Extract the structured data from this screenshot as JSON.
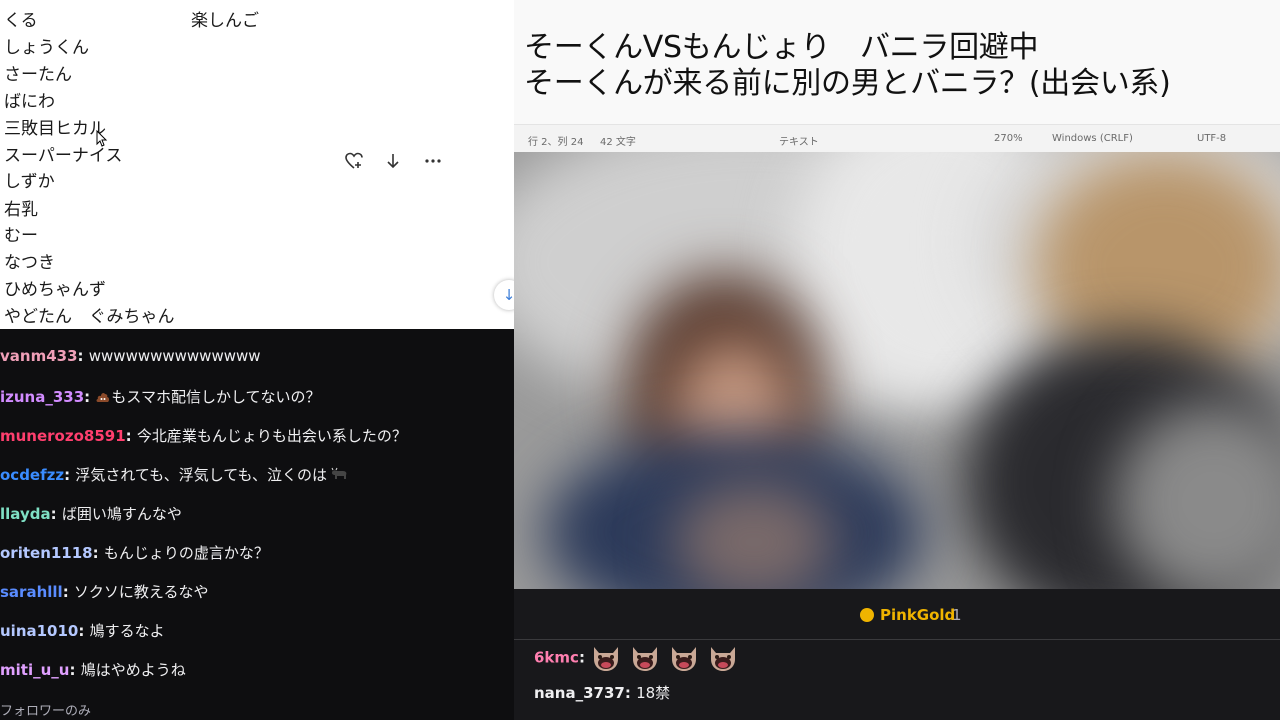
{
  "left_notes": {
    "names": [
      "くる",
      "しょうくん",
      "さーたん",
      "ばにわ",
      "三敗目ヒカル",
      "スーパーナイス",
      "しずか",
      "右乳",
      "むー",
      "なつき",
      "ひめちゃんず",
      "やどたん　ぐみちゃん"
    ],
    "extra_name": "楽しんご"
  },
  "middle_icons": [
    "heart-plus-icon",
    "arrow-down-icon",
    "more-icon"
  ],
  "left_chat": {
    "messages": [
      {
        "user": "vanm433",
        "color": "#f0a0b8",
        "text": "wwwwwwwwwwwwww"
      },
      {
        "user": "izuna_333",
        "color": "#d28cff",
        "text": "もスマホ配信しかしてないの？",
        "emoji": "poop-icon"
      },
      {
        "user": "munerozo8591",
        "color": "#ff3f6e",
        "text": "今北産業もんじょりも出会い系したの？"
      },
      {
        "user": "ocdefzz",
        "color": "#3a8cff",
        "text": "浮気されても、浮気しても、泣くのは",
        "emoji_after": "ox-icon"
      },
      {
        "user": "llayda",
        "color": "#7fe0c5",
        "text": "ば囲い鳩すんなや"
      },
      {
        "user": "oriten1118",
        "color": "#b4c8ff",
        "text": "もんじょりの虚言かな？"
      },
      {
        "user": "sarahlll",
        "color": "#5a8cff",
        "text": "ソクソに教えるなや"
      },
      {
        "user": "uina1010",
        "color": "#b4c8ff",
        "text": "鳩するなよ"
      },
      {
        "user": "miti_u_u",
        "color": "#e0a0ff",
        "text": "鳩はやめようね"
      }
    ],
    "followers_only": "フォロワーのみ"
  },
  "notepad": {
    "line1": "そーくんVSもんじょり　バニラ回避中",
    "line2": "そーくんが来る前に別の男とバニラ？(出会い系)",
    "status": {
      "position": "行 2、列 24",
      "chars": "42 文字",
      "type": "テキスト",
      "zoom": "270%",
      "eol": "Windows (CRLF)",
      "encoding": "UTF-8"
    }
  },
  "right_chat": {
    "pinned_name": "PinkGold",
    "pinned_count": "1",
    "messages": [
      {
        "user": "6kmc",
        "color": "#ff7fb0",
        "emote_count": 4
      },
      {
        "user": "nana_3737",
        "color": "#efeff1",
        "text": "18禁"
      }
    ]
  }
}
